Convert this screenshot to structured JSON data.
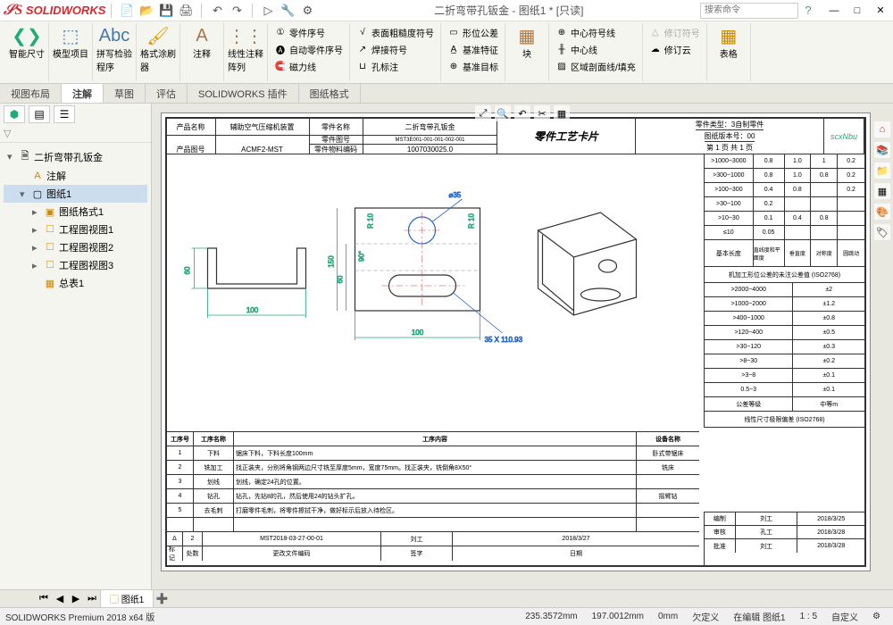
{
  "app": {
    "logo": "SOLIDWORKS",
    "title": "二折弯带孔钣金 - 图纸1 * [只读]",
    "search_placeholder": "搜索命令"
  },
  "ribbon": {
    "smart_dim": "智能尺寸",
    "model_item": "模型项目",
    "spell_check": "拼写检验程序",
    "format_painter": "格式涂刷器",
    "annotation": "注释",
    "linear_pattern": "线性注释阵列",
    "balloon": "零件序号",
    "auto_balloon": "自动零件序号",
    "magnetic": "磁力线",
    "surface_finish": "表面粗糙度符号",
    "weld_symbol": "焊接符号",
    "hole_callout": "孔标注",
    "geo_tol": "形位公差",
    "datum_feature": "基准特征",
    "datum_target": "基准目标",
    "block": "块",
    "center_mark": "中心符号线",
    "centerline": "中心线",
    "area_hatch": "区域剖面线/填充",
    "rev_symbol": "修订符号",
    "rev_cloud": "修订云",
    "table": "表格"
  },
  "tabs": {
    "view_layout": "视图布局",
    "annotate": "注解",
    "sketch": "草图",
    "evaluate": "评估",
    "sw_addins": "SOLIDWORKS 插件",
    "sheet_format": "图纸格式"
  },
  "tree": {
    "root": "二折弯带孔钣金",
    "annotations": "注解",
    "sheet1": "图纸1",
    "sheet_format1": "图纸格式1",
    "view1": "工程图视图1",
    "view2": "工程图视图2",
    "view3": "工程图视图3",
    "gen_table": "总表1"
  },
  "sheet": {
    "hdr": {
      "prod_name_lbl": "产品名称",
      "prod_name_val": "辅助空气压缩机装置",
      "prod_num_lbl": "产品图号",
      "prod_num_val": "ACMF2-MST",
      "part_name_lbl": "零件名称",
      "part_name_val": "二折弯带孔钣金",
      "part_num_lbl": "零件图号",
      "part_num_val": "MST3E001-001-001-002-001",
      "mat_code_lbl": "零件物料编码",
      "mat_code_val": "1007030025.0",
      "card_title": "零件工艺卡片",
      "part_type": "零件类型：3自制零件",
      "sheet_ver": "图纸版本号：00",
      "page": "第 1 页  共 1 页",
      "logo": "scxNbu"
    },
    "tol1": {
      "rows": [
        {
          "range": ">1000~3000",
          "a": "0.8",
          "b": "1.0",
          "c": "1"
        },
        {
          "range": ">300~1000",
          "a": "0.8",
          "b": "1.0",
          "c": "0.8"
        },
        {
          "range": ">100~300",
          "a": "0.4",
          "b": "0.8",
          "c": ""
        },
        {
          "range": ">30~100",
          "a": "0.2",
          "b": "",
          "c": ""
        },
        {
          "range": ">10~30",
          "a": "0.1",
          "b": "0.4",
          "c": "0.8"
        },
        {
          "range": "≤10",
          "a": "0.05",
          "b": "",
          "c": ""
        }
      ],
      "side": "0.2",
      "baselen": "基本长度",
      "c1": "直线度和平面度",
      "c2": "垂直度",
      "c3": "对称度",
      "c4": "圆跳动"
    },
    "tol2": {
      "title": "机加工形位公差的未注公差值 (ISO2768)",
      "rows": [
        {
          "range": ">2000~4000",
          "tol": "±2"
        },
        {
          "range": ">1000~2000",
          "tol": "±1.2"
        },
        {
          "range": ">400~1000",
          "tol": "±0.8"
        },
        {
          "range": ">120~400",
          "tol": "±0.5"
        },
        {
          "range": ">30~120",
          "tol": "±0.3"
        },
        {
          "range": ">8~30",
          "tol": "±0.2"
        },
        {
          "range": ">3~8",
          "tol": "±0.1"
        },
        {
          "range": "0.5~3",
          "tol": "±0.1"
        }
      ],
      "grade_lbl": "公差等级",
      "grade_val": "中等m",
      "subtitle": "线性尺寸极限偏差 (ISO2768)"
    },
    "proc": {
      "h1": "工序号",
      "h2": "工序名称",
      "h3": "工序内容",
      "h4": "设备名称",
      "rows": [
        {
          "n": "1",
          "name": "下料",
          "desc": "锯床下料，下料长度100mm",
          "eq": "卧式带锯床"
        },
        {
          "n": "2",
          "name": "铣加工",
          "desc": "找正装夹，分别将角钢两边尺寸铣至厚度5mm，宽度75mm。找正装夹，铣倒角8X50°",
          "eq": "铣床"
        },
        {
          "n": "3",
          "name": "划线",
          "desc": "划线，确定24孔的位置。",
          "eq": ""
        },
        {
          "n": "4",
          "name": "钻孔",
          "desc": "钻孔，先钻8的孔，然后使用24的钻头扩孔。",
          "eq": "摇臂钻"
        },
        {
          "n": "5",
          "name": "去毛刺",
          "desc": "打磨零件毛刺，将零件擦拭干净，做好标示后放入待检区。",
          "eq": ""
        },
        {
          "n": "",
          "name": "",
          "desc": "",
          "eq": ""
        }
      ],
      "footer": {
        "delta": "Δ",
        "rev": "2",
        "doc": "MST2018-03-27-00-01",
        "by1": "刘工",
        "date1": "2018/3/27",
        "mark": "标记",
        "count": "处数",
        "change_doc": "更改文件编码",
        "sign": "签字",
        "date_lbl": "日期"
      }
    },
    "rev": {
      "r1": {
        "a": "编制",
        "b": "刘工",
        "c": "2018/3/25"
      },
      "r2": {
        "a": "审核",
        "b": "孔工",
        "c": "2018/3/28"
      },
      "r3": {
        "a": "批准",
        "b": "刘工",
        "c": "2018/3/28"
      }
    },
    "dims": {
      "d100a": "100",
      "d60a": "60",
      "d60b": "60",
      "d150": "150",
      "d90": "90°",
      "r10a": "R 10",
      "r10b": "R 10",
      "dia35": "⌀35",
      "d100b": "100",
      "slot": "35 X 110.93"
    }
  },
  "bottom_tab": "图纸1",
  "status": {
    "product": "SOLIDWORKS Premium 2018 x64 版",
    "x": "235.3572mm",
    "y": "197.0012mm",
    "z": "0mm",
    "sel": "欠定义",
    "edit": "在编辑 图纸1",
    "scale": "1 : 5",
    "custom": "自定义"
  }
}
